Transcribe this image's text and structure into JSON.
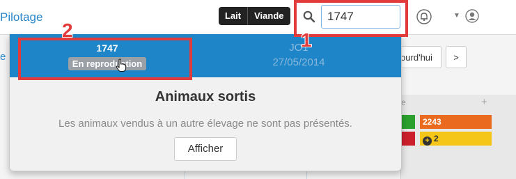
{
  "header": {
    "brand": "Pilotage",
    "toggles": [
      "Lait",
      "Viande"
    ],
    "search": {
      "value": "1747"
    },
    "icons": {
      "search": "search-icon",
      "bell": "bell-icon",
      "user": "user-icon",
      "caret": "caret-down-icon"
    }
  },
  "background": {
    "left_fragment": "e",
    "today_fragment": "ourd'hui",
    "next_label": ">",
    "panel_letter": "e",
    "panel_plus": "+",
    "tags": {
      "orange": "2243",
      "yellow": "2"
    }
  },
  "dropdown": {
    "results": [
      {
        "title": "1747",
        "badge": "En reproduction"
      },
      {
        "title": "JO1",
        "date": "27/05/2014"
      }
    ],
    "empty_title": "Animaux sortis",
    "empty_text": "Les animaux vendus à un autre élevage ne sont pas présentés.",
    "show_button": "Afficher"
  },
  "callouts": [
    "1",
    "2"
  ],
  "colors": {
    "accent": "#1e85c9",
    "callout": "#e23b3b",
    "tag_green": "#2ca02c",
    "tag_red": "#cc1f2c",
    "tag_orange": "#ea6a1f",
    "tag_yellow": "#f5c518"
  }
}
